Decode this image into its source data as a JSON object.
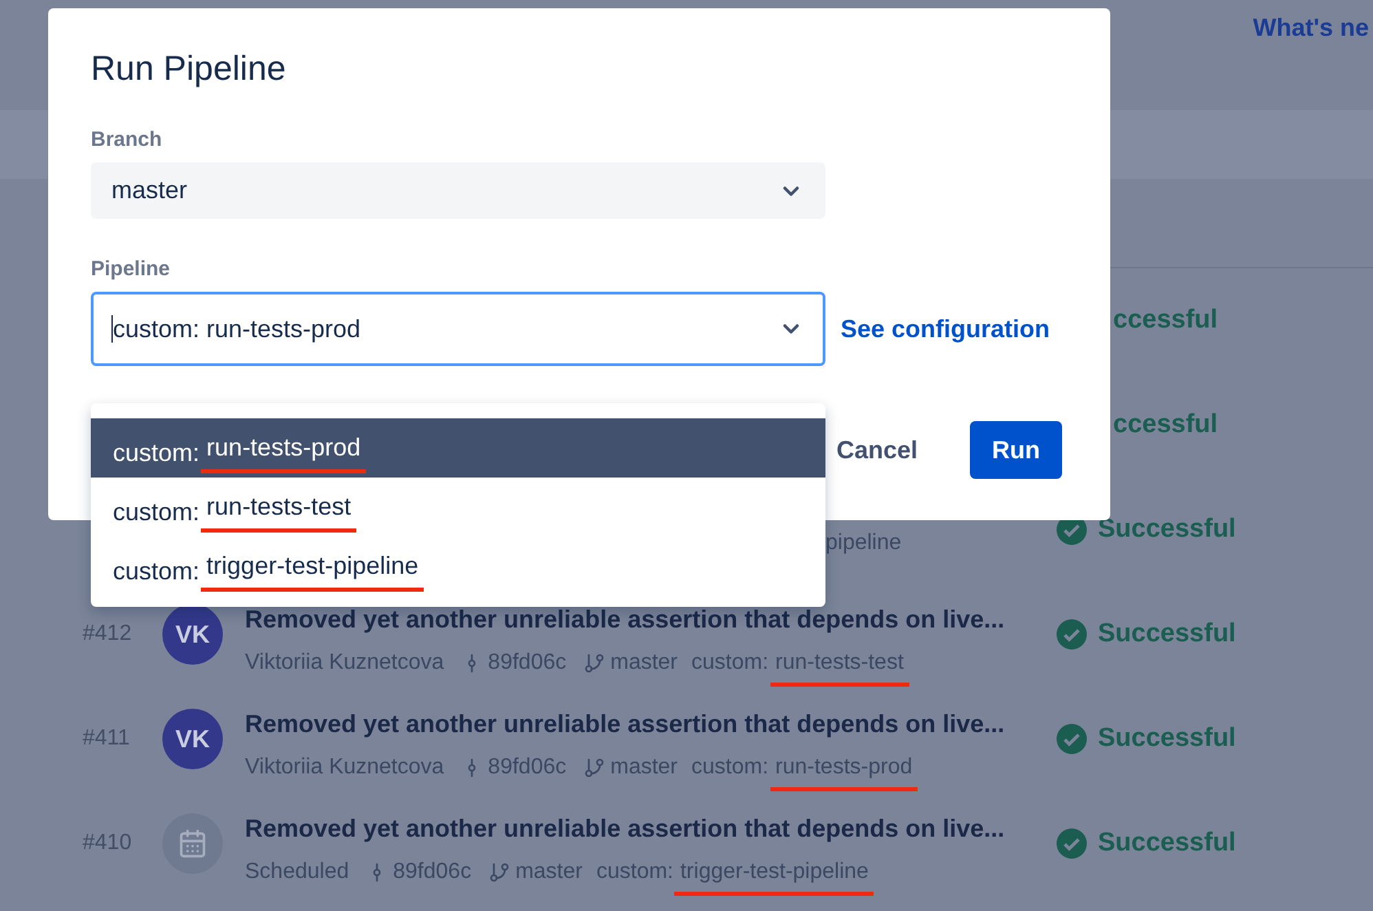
{
  "header": {
    "link": "What's ne"
  },
  "rows": [
    {
      "status": {
        "text": "ccessful",
        "icon": false
      }
    },
    {
      "status": {
        "text": "ccessful",
        "icon": false
      }
    },
    {
      "meta_fragment": "pipeline",
      "status": {
        "text": "Successful",
        "icon": true
      }
    },
    {
      "number": "#412",
      "avatar": {
        "kind": "initials",
        "text": "VK"
      },
      "title": "Removed yet another unreliable assertion that depends on live...",
      "meta": {
        "author": "Viktoriia Kuznetcova",
        "commit": "89fd06c",
        "branch": "master",
        "pipeline_prefix": "custom:",
        "pipeline_name": "run-tests-test",
        "underlined": true
      },
      "status": {
        "text": "Successful",
        "icon": true
      }
    },
    {
      "number": "#411",
      "avatar": {
        "kind": "initials",
        "text": "VK"
      },
      "title": "Removed yet another unreliable assertion that depends on live...",
      "meta": {
        "author": "Viktoriia Kuznetcova",
        "commit": "89fd06c",
        "branch": "master",
        "pipeline_prefix": "custom:",
        "pipeline_name": "run-tests-prod",
        "underlined": true
      },
      "status": {
        "text": "Successful",
        "icon": true
      }
    },
    {
      "number": "#410",
      "avatar": {
        "kind": "scheduled"
      },
      "title": "Removed yet another unreliable assertion that depends on live...",
      "meta": {
        "author": "Scheduled",
        "commit": "89fd06c",
        "branch": "master",
        "pipeline_prefix": "custom:",
        "pipeline_name": "trigger-test-pipeline",
        "underlined": true
      },
      "status": {
        "text": "Successful",
        "icon": true
      }
    }
  ],
  "dialog": {
    "title": "Run Pipeline",
    "branch": {
      "label": "Branch",
      "value": "master"
    },
    "pipeline": {
      "label": "Pipeline",
      "value": "custom: run-tests-prod",
      "focused": true,
      "expanded": true
    },
    "link": "See configuration",
    "buttons": [
      {
        "label": "Cancel",
        "kind": "subtle"
      },
      {
        "label": "Run",
        "kind": "primary"
      }
    ],
    "options": [
      {
        "prefix": "custom:",
        "name": "run-tests-prod",
        "selected": true,
        "underlined": true
      },
      {
        "prefix": "custom:",
        "name": "run-tests-test",
        "selected": false,
        "underlined": true
      },
      {
        "prefix": "custom:",
        "name": "trigger-test-pipeline",
        "selected": false,
        "underlined": true
      }
    ]
  }
}
